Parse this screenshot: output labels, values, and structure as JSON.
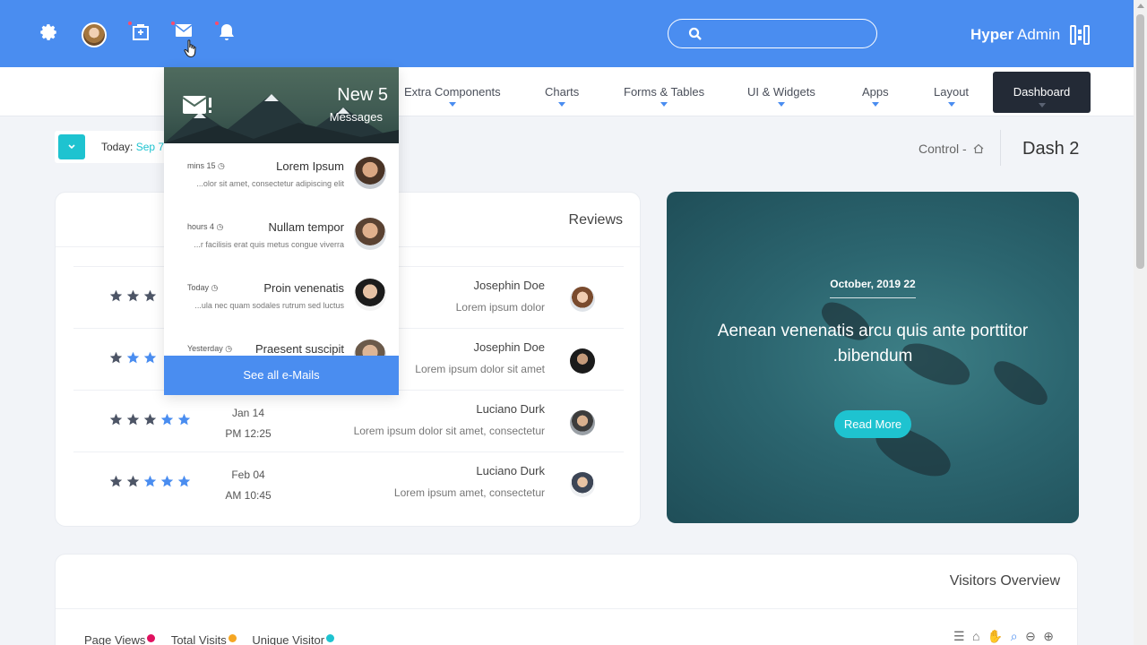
{
  "topbar": {
    "brand_bold": "Hyper",
    "brand_light": "Admin",
    "search_placeholder": ""
  },
  "nav": {
    "items": [
      "Extra Components",
      "Charts",
      "Forms & Tables",
      "UI & Widgets",
      "Apps",
      "Layout"
    ],
    "active": "Dashboard"
  },
  "subheader": {
    "today_label": "Today:",
    "today_value": "Sep 7",
    "breadcrumb": "Control -",
    "page_title": "Dash 2"
  },
  "reviews": {
    "title": "Reviews",
    "rows": [
      {
        "stars_filled": 3,
        "stars_blue": 0,
        "date": "",
        "time": "",
        "name": "Josephin Doe",
        "desc": "Lorem ipsum dolor"
      },
      {
        "stars_filled": 1,
        "stars_blue": 2,
        "date": "",
        "time": "",
        "name": "Josephin Doe",
        "desc": "Lorem ipsum dolor sit amet"
      },
      {
        "stars_filled": 3,
        "stars_blue": 2,
        "date": "Jan 14",
        "time": "PM 12:25",
        "name": "Luciano Durk",
        "desc": "Lorem ipsum dolor sit amet, consectetur"
      },
      {
        "stars_filled": 2,
        "stars_blue": 3,
        "date": "Feb 04",
        "time": "AM 10:45",
        "name": "Luciano Durk",
        "desc": "Lorem ipsum amet, consectetur"
      }
    ]
  },
  "hero": {
    "date": "October, 2019 22",
    "title": "Aenean venenatis arcu quis ante porttitor .bibendum",
    "button": "Read More"
  },
  "visitors": {
    "title": "Visitors Overview",
    "legend": [
      {
        "label": "Page Views",
        "color": "#e0115f"
      },
      {
        "label": "Total Visits",
        "color": "#f5a623"
      },
      {
        "label": "Unique Visitor",
        "color": "#1ec3d0"
      }
    ]
  },
  "messages": {
    "count_text": "New 5",
    "sub_text": "Messages",
    "items": [
      {
        "time": "mins 15",
        "name": "Lorem Ipsum",
        "text": "...olor sit amet, consectetur adipiscing elit"
      },
      {
        "time": "hours 4",
        "name": "Nullam tempor",
        "text": "...r facilisis erat quis metus congue viverra"
      },
      {
        "time": "Today",
        "name": "Proin venenatis",
        "text": "...ula nec quam sodales rutrum sed luctus"
      },
      {
        "time": "Yesterday",
        "name": "Praesent suscipit",
        "text": ""
      }
    ],
    "see_all": "See all e-Mails"
  },
  "colors": {
    "primary": "#4a8df0",
    "accent": "#1ec3d0",
    "dark": "#232a36"
  }
}
